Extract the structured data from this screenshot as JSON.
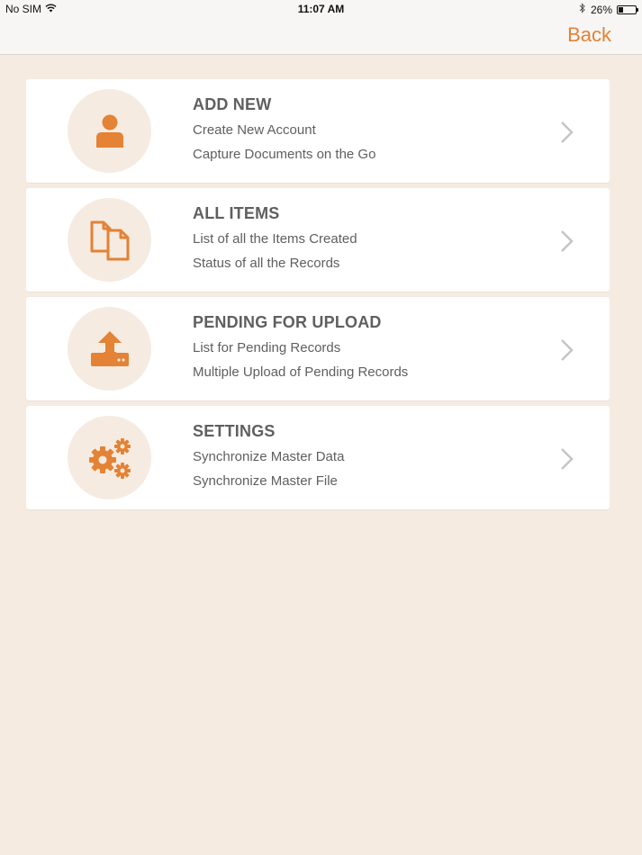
{
  "status_bar": {
    "carrier": "No SIM",
    "time": "11:07 AM",
    "battery_text": "26%",
    "battery_level": 0.26,
    "icons": [
      "wifi-icon",
      "bluetooth-icon",
      "battery-icon"
    ]
  },
  "nav": {
    "back_label": "Back"
  },
  "colors": {
    "accent": "#e48235",
    "background": "#f5ebe1",
    "text": "#5f5f5f"
  },
  "menu": {
    "items": [
      {
        "title": "ADD NEW",
        "line1": "Create New Account",
        "line2": "Capture Documents on the Go",
        "icon": "user-icon"
      },
      {
        "title": "ALL ITEMS",
        "line1": "List of all the Items Created",
        "line2": "Status of all the Records",
        "icon": "documents-icon"
      },
      {
        "title": "PENDING FOR UPLOAD",
        "line1": "List for Pending Records",
        "line2": "Multiple Upload of Pending Records",
        "icon": "upload-icon"
      },
      {
        "title": "SETTINGS",
        "line1": "Synchronize Master Data",
        "line2": "Synchronize Master File",
        "icon": "gears-icon"
      }
    ]
  }
}
